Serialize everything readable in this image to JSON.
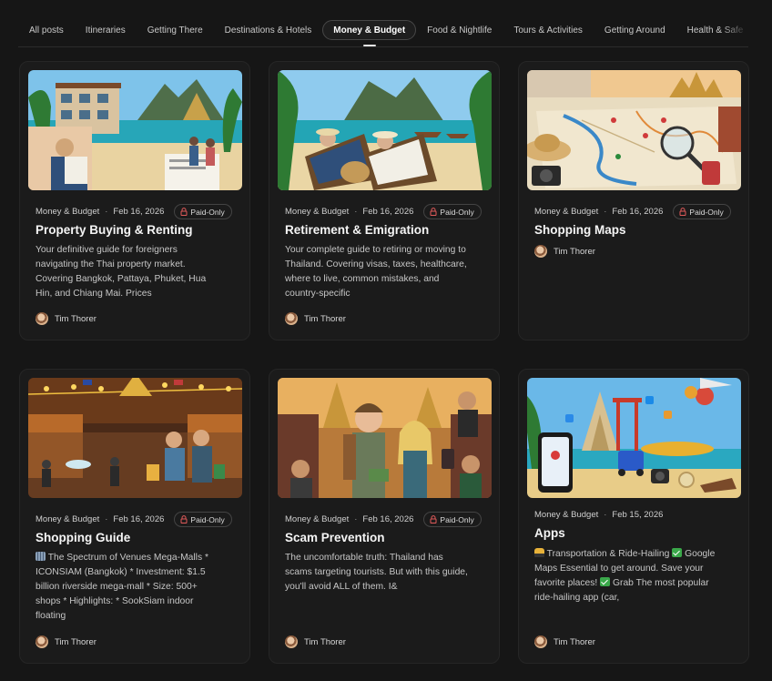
{
  "tabs": [
    {
      "label": "All posts",
      "active": false
    },
    {
      "label": "Itineraries",
      "active": false
    },
    {
      "label": "Getting There",
      "active": false
    },
    {
      "label": "Destinations & Hotels",
      "active": false
    },
    {
      "label": "Money & Budget",
      "active": true
    },
    {
      "label": "Food & Nightlife",
      "active": false
    },
    {
      "label": "Tours & Activities",
      "active": false
    },
    {
      "label": "Getting Around",
      "active": false
    },
    {
      "label": "Health & Safe",
      "active": false
    }
  ],
  "posts": [
    {
      "category": "Money & Budget",
      "date": "Feb 16, 2026",
      "badge": "Paid-Only",
      "title": "Property Buying & Renting",
      "excerpt_lines": [
        "Your definitive guide for foreigners",
        "navigating the Thai property market.",
        "Covering Bangkok, Pattaya, Phuket, Hua",
        "Hin, and Chiang Mai. Prices"
      ],
      "author": "Tim Thorer",
      "image_icon": "property-beach-image"
    },
    {
      "category": "Money & Budget",
      "date": "Feb 16, 2026",
      "badge": "Paid-Only",
      "title": "Retirement & Emigration",
      "excerpt_lines": [
        "Your complete guide to retiring or moving to",
        "Thailand. Covering visas, taxes, healthcare,",
        "where to live, common mistakes, and",
        "country-specific"
      ],
      "author": "Tim Thorer",
      "image_icon": "retirement-beach-image"
    },
    {
      "category": "Money & Budget",
      "date": "Feb 16, 2026",
      "badge": "Paid-Only",
      "title": "Shopping Maps",
      "excerpt_lines": [],
      "author": "Tim Thorer",
      "image_icon": "shopping-map-image"
    },
    {
      "category": "Money & Budget",
      "date": "Feb 16, 2026",
      "badge": "Paid-Only",
      "title": "Shopping Guide",
      "excerpt_lines": [
        "The Spectrum of Venues Mega-Malls *",
        "ICONSIAM (Bangkok) * Investment: $1.5",
        "billion riverside mega-mall * Size: 500+",
        "shops * Highlights: * SookSiam indoor",
        "floating"
      ],
      "author": "Tim Thorer",
      "image_icon": "shopping-market-image"
    },
    {
      "category": "Money & Budget",
      "date": "Feb 16, 2026",
      "badge": "Paid-Only",
      "title": "Scam Prevention",
      "excerpt_lines": [
        "The uncomfortable truth: Thailand has",
        "scams targeting tourists. But with this guide,",
        "you'll avoid ALL of them. I&"
      ],
      "author": "Tim Thorer",
      "image_icon": "scam-tourists-image"
    },
    {
      "category": "Money & Budget",
      "date": "Feb 15, 2026",
      "badge": "",
      "title": "Apps",
      "excerpt_lines": [
        " Transportation & Ride-Hailing",
        " Google",
        "Maps Essential to get around. Save your",
        "favorite places!",
        " Grab The most popular",
        "ride-hailing app (car,"
      ],
      "author": "Tim Thorer",
      "image_icon": "travel-apps-image"
    }
  ],
  "colors": {
    "background": "#161616",
    "card": "#1b1b1b",
    "lock": "#e05a5a"
  }
}
